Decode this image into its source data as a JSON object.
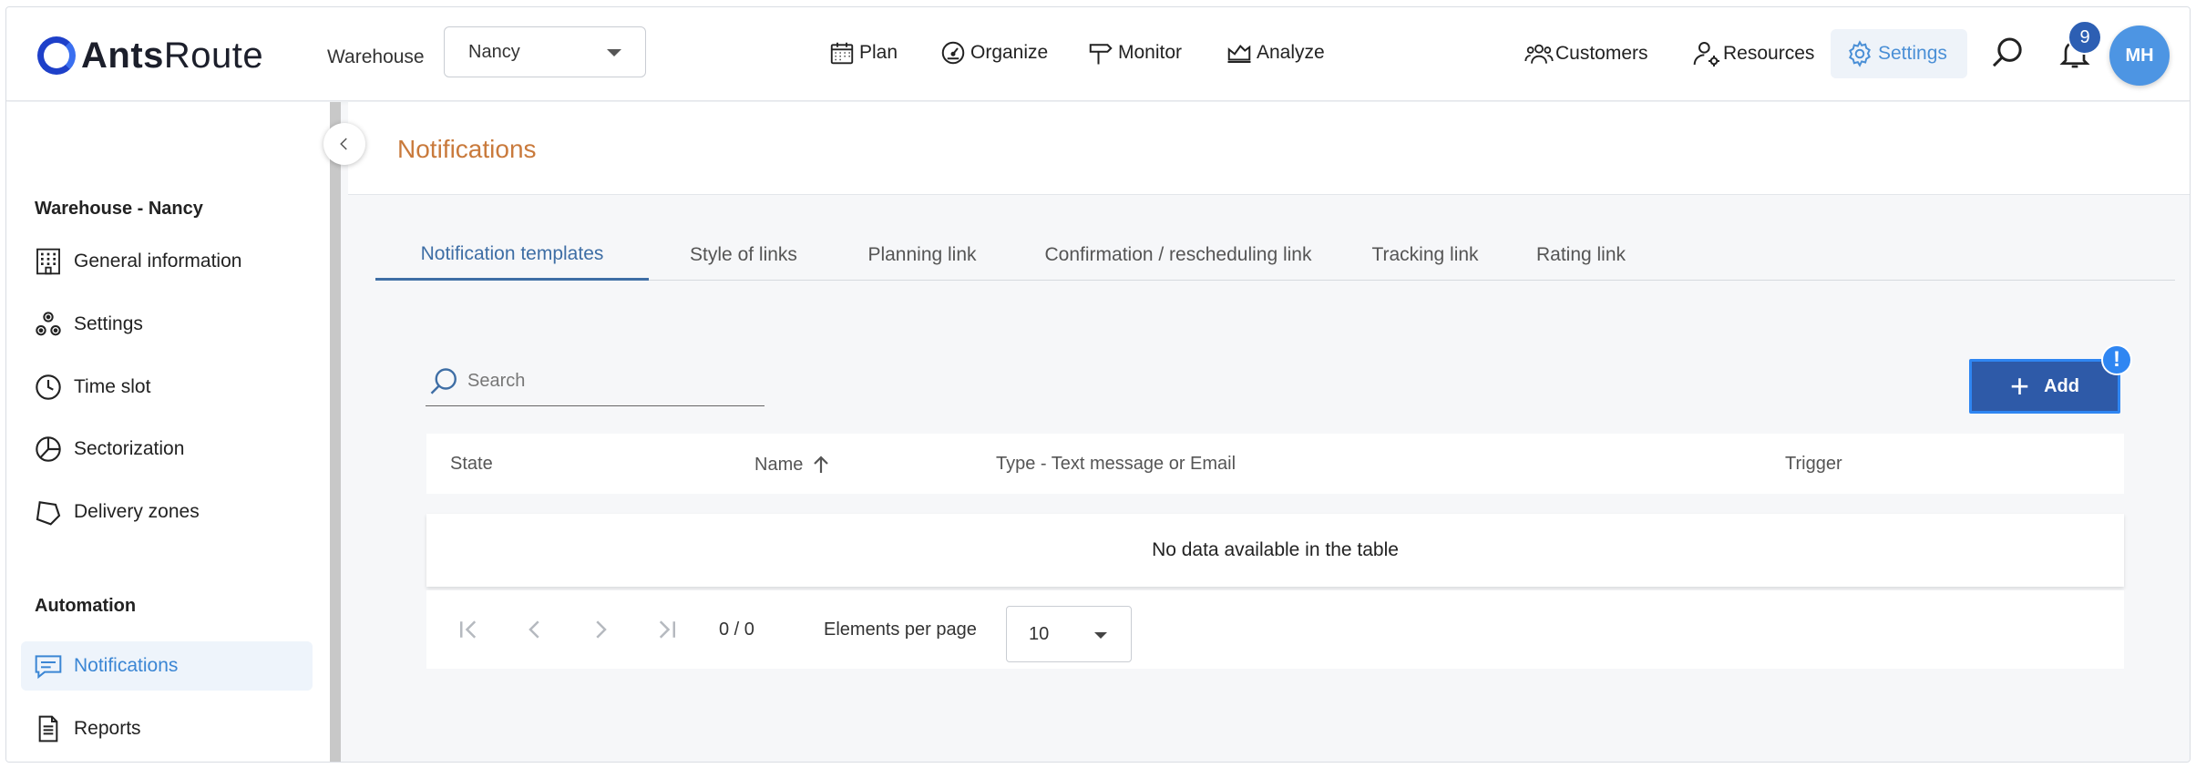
{
  "header": {
    "logo_bold": "Ants",
    "logo_light": "Route",
    "warehouse_label": "Warehouse",
    "warehouse_value": "Nancy",
    "nav": [
      {
        "label": "Plan",
        "icon": "calendar-icon"
      },
      {
        "label": "Organize",
        "icon": "gauge-icon"
      },
      {
        "label": "Monitor",
        "icon": "signpost-icon"
      },
      {
        "label": "Analyze",
        "icon": "chart-icon"
      }
    ],
    "right_nav": [
      {
        "label": "Customers",
        "icon": "customers-icon"
      },
      {
        "label": "Resources",
        "icon": "resources-icon"
      },
      {
        "label": "Settings",
        "icon": "gear-icon"
      }
    ],
    "notification_count": "9",
    "avatar_initials": "MH"
  },
  "sidebar": {
    "section1_title": "Warehouse - Nancy",
    "section1_items": [
      {
        "label": "General information",
        "icon": "building-icon"
      },
      {
        "label": "Settings",
        "icon": "cogs-icon"
      },
      {
        "label": "Time slot",
        "icon": "clock-icon"
      },
      {
        "label": "Sectorization",
        "icon": "pie-icon"
      },
      {
        "label": "Delivery zones",
        "icon": "polygon-icon"
      }
    ],
    "section2_title": "Automation",
    "section2_items": [
      {
        "label": "Notifications",
        "icon": "message-icon",
        "active": true
      },
      {
        "label": "Reports",
        "icon": "document-icon"
      }
    ]
  },
  "page": {
    "title": "Notifications",
    "tabs": [
      {
        "label": "Notification templates",
        "active": true
      },
      {
        "label": "Style of links"
      },
      {
        "label": "Planning link"
      },
      {
        "label": "Confirmation / rescheduling link"
      },
      {
        "label": "Tracking link"
      },
      {
        "label": "Rating link"
      }
    ],
    "search_placeholder": "Search",
    "add_label": "Add",
    "alert_mark": "!",
    "columns": [
      "State",
      "Name",
      "Type - Text message or Email",
      "Trigger"
    ],
    "empty_message": "No data available in the table",
    "pagination": {
      "range": "0 / 0",
      "per_page_label": "Elements per page",
      "per_page_value": "10"
    }
  }
}
